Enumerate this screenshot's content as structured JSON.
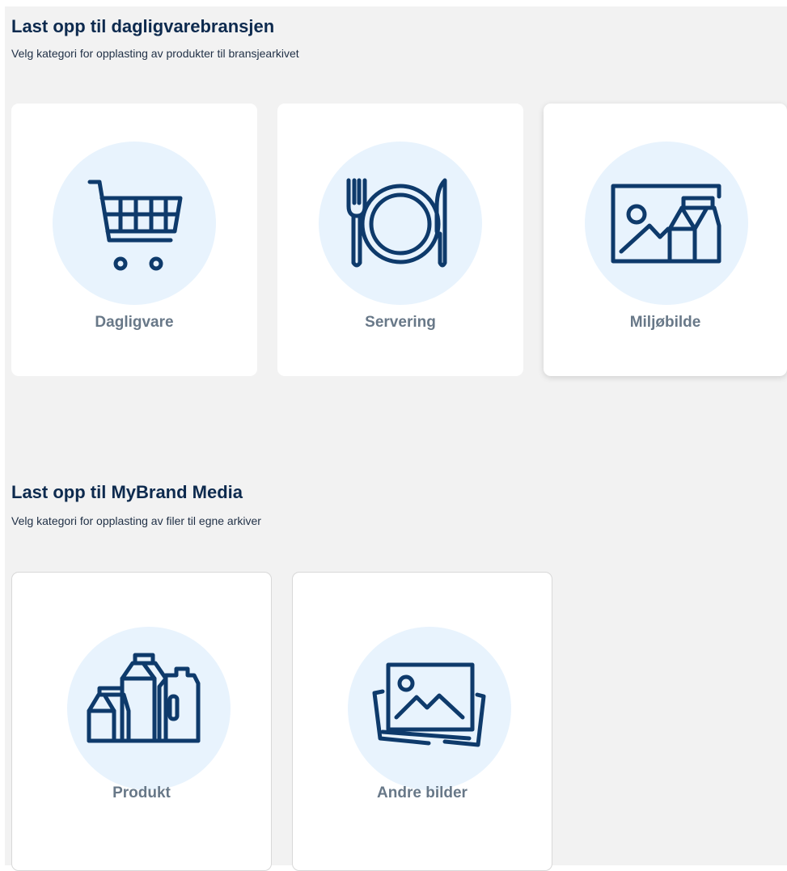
{
  "sections": [
    {
      "title": "Last opp til dagligvarebransjen",
      "subtitle": "Velg kategori for opplasting av produkter til bransjearkivet",
      "cards": [
        {
          "label": "Dagligvare",
          "icon": "shopping-cart-icon"
        },
        {
          "label": "Servering",
          "icon": "plate-cutlery-icon"
        },
        {
          "label": "Miljøbilde",
          "icon": "environment-image-icon"
        }
      ]
    },
    {
      "title": "Last opp til MyBrand Media",
      "subtitle": "Velg kategori for opplasting av filer til egne arkiver",
      "cards": [
        {
          "label": "Produkt",
          "icon": "product-packages-icon"
        },
        {
          "label": "Andre bilder",
          "icon": "image-stack-icon"
        }
      ]
    }
  ],
  "colors": {
    "background": "#f2f2f2",
    "card": "#ffffff",
    "icon_circle": "#e8f3fd",
    "icon_stroke": "#0e3a6b",
    "title": "#0d2a4e",
    "label": "#687888"
  }
}
